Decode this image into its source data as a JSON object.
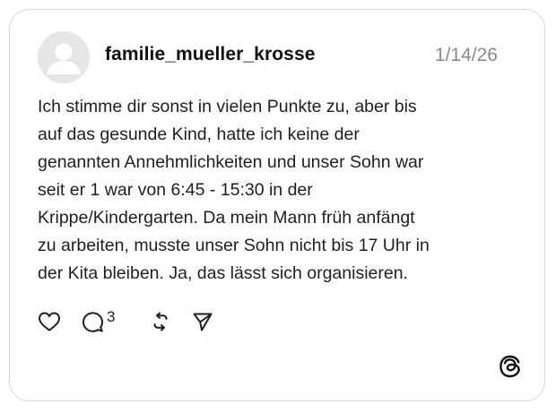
{
  "post": {
    "username": "familie_mueller_krosse",
    "date": "1/14/26",
    "text": "Ich stimme dir sonst in vielen Punkte zu, aber bis\nauf das gesunde Kind, hatte ich keine der\ngenannten Annehmlichkeiten und unser Sohn war\nseit er 1 war von 6:45 - 15:30 in der\nKrippe/Kindergarten. Da mein Mann früh anfängt\nzu arbeiten, musste unser  Sohn nicht bis 17 Uhr in\nder Kita bleiben. Ja, das lässt sich organisieren.",
    "reply_count": "3"
  },
  "icons": {
    "avatar": "default-avatar-icon",
    "like": "heart-icon",
    "reply": "comment-bubble-icon",
    "repost": "repost-icon",
    "share": "send-icon",
    "brand": "threads-logo-icon"
  },
  "colors": {
    "text": "#1f1f1f",
    "muted": "#8a8a8a",
    "border": "#d9d9d9",
    "avatar_bg": "#e6e6e6",
    "avatar_fg": "#ffffff"
  }
}
